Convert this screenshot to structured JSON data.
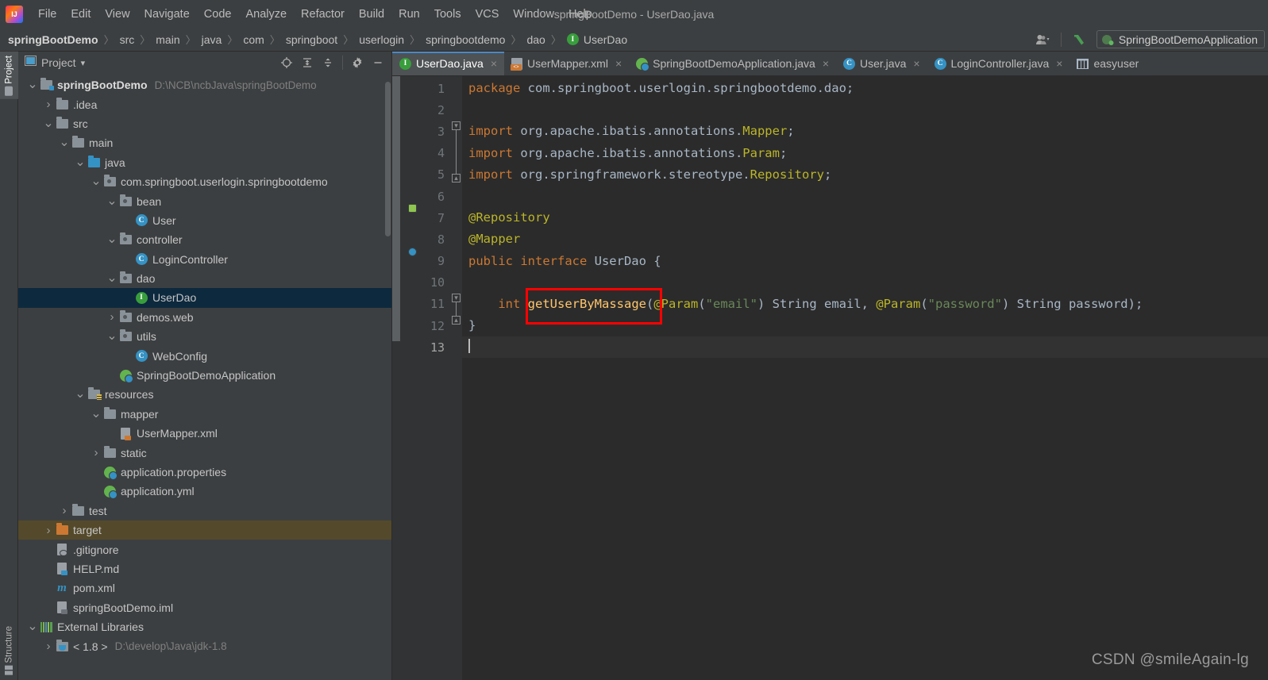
{
  "window": {
    "title": "springBootDemo - UserDao.java"
  },
  "menubar": {
    "items": [
      {
        "label": "File",
        "mnemonic": "F"
      },
      {
        "label": "Edit",
        "mnemonic": "E"
      },
      {
        "label": "View",
        "mnemonic": "V"
      },
      {
        "label": "Navigate",
        "mnemonic": "N"
      },
      {
        "label": "Code",
        "mnemonic": "C"
      },
      {
        "label": "Analyze",
        "mnemonic": "z"
      },
      {
        "label": "Refactor",
        "mnemonic": "R"
      },
      {
        "label": "Build",
        "mnemonic": "B"
      },
      {
        "label": "Run",
        "mnemonic": "u"
      },
      {
        "label": "Tools",
        "mnemonic": "T"
      },
      {
        "label": "VCS",
        "mnemonic": "S"
      },
      {
        "label": "Window",
        "mnemonic": "W"
      },
      {
        "label": "Help",
        "mnemonic": "H"
      }
    ]
  },
  "breadcrumb": {
    "separator": "〉",
    "items": [
      {
        "label": "springBootDemo",
        "bold": true,
        "icon": ""
      },
      {
        "label": "src",
        "bold": false,
        "icon": ""
      },
      {
        "label": "main",
        "bold": false,
        "icon": ""
      },
      {
        "label": "java",
        "bold": false,
        "icon": ""
      },
      {
        "label": "com",
        "bold": false,
        "icon": ""
      },
      {
        "label": "springboot",
        "bold": false,
        "icon": ""
      },
      {
        "label": "userlogin",
        "bold": false,
        "icon": ""
      },
      {
        "label": "springbootdemo",
        "bold": false,
        "icon": ""
      },
      {
        "label": "dao",
        "bold": false,
        "icon": ""
      },
      {
        "label": "UserDao",
        "bold": false,
        "icon": "interface-icon"
      }
    ],
    "right": {
      "user_icon": "user-dropdown-icon",
      "hammer_icon": "build-hammer-icon",
      "run_config_label": "SpringBootDemoApplication",
      "run_config_icon": "spring-boot-icon"
    }
  },
  "toolstrip": {
    "project_tab": "Project",
    "structure_tab": "Structure"
  },
  "project_panel": {
    "title": "Project",
    "dropdown_glyph": "▾",
    "icons": [
      {
        "name": "locate-icon",
        "glyph": "⊕"
      },
      {
        "name": "expand-all-icon",
        "glyph": "⇕"
      },
      {
        "name": "collapse-all-icon",
        "glyph": "⇵"
      },
      {
        "name": "settings-gear-icon",
        "glyph": "⚙"
      },
      {
        "name": "hide-panel-icon",
        "glyph": "—"
      }
    ],
    "tree": [
      {
        "indent": 0,
        "twist": "down",
        "icon": "module-folder-icon",
        "label": "springBootDemo",
        "bold": true,
        "path": "D:\\NCB\\ncbJava\\springBootDemo",
        "state": "normal"
      },
      {
        "indent": 1,
        "twist": "right",
        "icon": "folder-icon",
        "label": ".idea",
        "bold": false,
        "path": "",
        "state": "normal"
      },
      {
        "indent": 1,
        "twist": "down",
        "icon": "folder-icon",
        "label": "src",
        "bold": false,
        "path": "",
        "state": "normal"
      },
      {
        "indent": 2,
        "twist": "down",
        "icon": "folder-icon",
        "label": "main",
        "bold": false,
        "path": "",
        "state": "normal"
      },
      {
        "indent": 3,
        "twist": "down",
        "icon": "source-folder-icon",
        "label": "java",
        "bold": false,
        "path": "",
        "state": "normal"
      },
      {
        "indent": 4,
        "twist": "down",
        "icon": "package-icon",
        "label": "com.springboot.userlogin.springbootdemo",
        "bold": false,
        "path": "",
        "state": "normal"
      },
      {
        "indent": 5,
        "twist": "down",
        "icon": "package-icon",
        "label": "bean",
        "bold": false,
        "path": "",
        "state": "normal"
      },
      {
        "indent": 6,
        "twist": "none",
        "icon": "class-icon",
        "label": "User",
        "bold": false,
        "path": "",
        "state": "normal"
      },
      {
        "indent": 5,
        "twist": "down",
        "icon": "package-icon",
        "label": "controller",
        "bold": false,
        "path": "",
        "state": "normal"
      },
      {
        "indent": 6,
        "twist": "none",
        "icon": "class-icon",
        "label": "LoginController",
        "bold": false,
        "path": "",
        "state": "normal"
      },
      {
        "indent": 5,
        "twist": "down",
        "icon": "package-icon",
        "label": "dao",
        "bold": false,
        "path": "",
        "state": "normal"
      },
      {
        "indent": 6,
        "twist": "none",
        "icon": "interface-icon",
        "label": "UserDao",
        "bold": false,
        "path": "",
        "state": "selected"
      },
      {
        "indent": 5,
        "twist": "right",
        "icon": "package-icon",
        "label": "demos.web",
        "bold": false,
        "path": "",
        "state": "normal"
      },
      {
        "indent": 5,
        "twist": "down",
        "icon": "package-icon",
        "label": "utils",
        "bold": false,
        "path": "",
        "state": "normal"
      },
      {
        "indent": 6,
        "twist": "none",
        "icon": "class-icon",
        "label": "WebConfig",
        "bold": false,
        "path": "",
        "state": "normal"
      },
      {
        "indent": 5,
        "twist": "none",
        "icon": "spring-boot-app-icon",
        "label": "SpringBootDemoApplication",
        "bold": false,
        "path": "",
        "state": "normal"
      },
      {
        "indent": 3,
        "twist": "down",
        "icon": "resources-folder-icon",
        "label": "resources",
        "bold": false,
        "path": "",
        "state": "normal"
      },
      {
        "indent": 4,
        "twist": "down",
        "icon": "folder-icon",
        "label": "mapper",
        "bold": false,
        "path": "",
        "state": "normal"
      },
      {
        "indent": 5,
        "twist": "none",
        "icon": "xml-file-icon",
        "label": "UserMapper.xml",
        "bold": false,
        "path": "",
        "state": "normal"
      },
      {
        "indent": 4,
        "twist": "right",
        "icon": "folder-icon",
        "label": "static",
        "bold": false,
        "path": "",
        "state": "normal"
      },
      {
        "indent": 4,
        "twist": "none",
        "icon": "spring-config-icon",
        "label": "application.properties",
        "bold": false,
        "path": "",
        "state": "normal"
      },
      {
        "indent": 4,
        "twist": "none",
        "icon": "spring-config-icon",
        "label": "application.yml",
        "bold": false,
        "path": "",
        "state": "normal"
      },
      {
        "indent": 2,
        "twist": "right",
        "icon": "folder-icon",
        "label": "test",
        "bold": false,
        "path": "",
        "state": "normal"
      },
      {
        "indent": 1,
        "twist": "right",
        "icon": "target-folder-icon",
        "label": "target",
        "bold": false,
        "path": "",
        "state": "highlight"
      },
      {
        "indent": 1,
        "twist": "none",
        "icon": "gitignore-file-icon",
        "label": ".gitignore",
        "bold": false,
        "path": "",
        "state": "normal"
      },
      {
        "indent": 1,
        "twist": "none",
        "icon": "markdown-file-icon",
        "label": "HELP.md",
        "bold": false,
        "path": "",
        "state": "normal"
      },
      {
        "indent": 1,
        "twist": "none",
        "icon": "maven-file-icon",
        "label": "pom.xml",
        "bold": false,
        "path": "",
        "state": "normal"
      },
      {
        "indent": 1,
        "twist": "none",
        "icon": "iml-file-icon",
        "label": "springBootDemo.iml",
        "bold": false,
        "path": "",
        "state": "normal"
      },
      {
        "indent": 0,
        "twist": "down",
        "icon": "external-libraries-icon",
        "label": "External Libraries",
        "bold": false,
        "path": "",
        "state": "normal"
      },
      {
        "indent": 1,
        "twist": "right",
        "icon": "jdk-folder-icon",
        "label": "< 1.8 >",
        "bold": false,
        "path": "D:\\develop\\Java\\jdk-1.8",
        "state": "normal"
      }
    ]
  },
  "editor_tabs": [
    {
      "label": "UserDao.java",
      "icon": "interface-icon",
      "active": true,
      "closable": true
    },
    {
      "label": "UserMapper.xml",
      "icon": "xml-file-icon",
      "active": false,
      "closable": true
    },
    {
      "label": "SpringBootDemoApplication.java",
      "icon": "spring-boot-app-icon",
      "active": false,
      "closable": true
    },
    {
      "label": "User.java",
      "icon": "class-icon",
      "active": false,
      "closable": true
    },
    {
      "label": "LoginController.java",
      "icon": "class-icon",
      "active": false,
      "closable": true
    },
    {
      "label": "easyuser",
      "icon": "database-table-icon",
      "active": false,
      "closable": false
    }
  ],
  "editor": {
    "line_numbers": [
      "1",
      "2",
      "3",
      "4",
      "5",
      "6",
      "7",
      "8",
      "9",
      "10",
      "11",
      "12",
      "13"
    ],
    "current_line": 13,
    "gutter_marks": [
      {
        "line": 7,
        "icon": "spring-bean-icon"
      },
      {
        "line": 9,
        "icon": "spring-mapper-icon"
      }
    ],
    "lines": [
      {
        "n": 1,
        "tokens": [
          {
            "t": "package",
            "c": "kw"
          },
          {
            "t": " com.springboot.userlogin.springbootdemo.dao;",
            "c": "plain"
          }
        ]
      },
      {
        "n": 2,
        "tokens": []
      },
      {
        "n": 3,
        "tokens": [
          {
            "t": "import",
            "c": "kw"
          },
          {
            "t": " org.apache.ibatis.annotations.",
            "c": "plain"
          },
          {
            "t": "Mapper",
            "c": "ann"
          },
          {
            "t": ";",
            "c": "plain"
          }
        ]
      },
      {
        "n": 4,
        "tokens": [
          {
            "t": "import",
            "c": "kw"
          },
          {
            "t": " org.apache.ibatis.annotations.",
            "c": "plain"
          },
          {
            "t": "Param",
            "c": "ann"
          },
          {
            "t": ";",
            "c": "plain"
          }
        ]
      },
      {
        "n": 5,
        "tokens": [
          {
            "t": "import",
            "c": "kw"
          },
          {
            "t": " org.springframework.stereotype.",
            "c": "plain"
          },
          {
            "t": "Repository",
            "c": "ann"
          },
          {
            "t": ";",
            "c": "plain"
          }
        ]
      },
      {
        "n": 6,
        "tokens": []
      },
      {
        "n": 7,
        "tokens": [
          {
            "t": "@Repository",
            "c": "ann"
          }
        ]
      },
      {
        "n": 8,
        "tokens": [
          {
            "t": "@Mapper",
            "c": "ann"
          }
        ]
      },
      {
        "n": 9,
        "tokens": [
          {
            "t": "public interface ",
            "c": "kw"
          },
          {
            "t": "UserDao",
            "c": "cls"
          },
          {
            "t": " {",
            "c": "plain"
          }
        ]
      },
      {
        "n": 10,
        "tokens": []
      },
      {
        "n": 11,
        "tokens": [
          {
            "t": "    ",
            "c": "plain"
          },
          {
            "t": "int",
            "c": "kw"
          },
          {
            "t": " ",
            "c": "plain"
          },
          {
            "t": "getUserByMassage",
            "c": "mth"
          },
          {
            "t": "(",
            "c": "plain"
          },
          {
            "t": "@Param",
            "c": "ann"
          },
          {
            "t": "(",
            "c": "plain"
          },
          {
            "t": "\"email\"",
            "c": "str"
          },
          {
            "t": ") String email, ",
            "c": "plain"
          },
          {
            "t": "@Param",
            "c": "ann"
          },
          {
            "t": "(",
            "c": "plain"
          },
          {
            "t": "\"password\"",
            "c": "str"
          },
          {
            "t": ") String password);",
            "c": "plain"
          }
        ]
      },
      {
        "n": 12,
        "tokens": [
          {
            "t": "}",
            "c": "plain"
          }
        ]
      },
      {
        "n": 13,
        "tokens": []
      }
    ],
    "annotation_box": {
      "target_text": "getUserByMassage",
      "color": "#ff0000",
      "line": 11
    }
  },
  "watermark": "CSDN @smileAgain-lg",
  "colors": {
    "background": "#3c3f41",
    "editor_bg": "#2b2b2b",
    "gutter_bg": "#313335",
    "selection": "#0d293e",
    "highlight": "#54492a",
    "accent": "#4a88c7",
    "keyword": "#cc7832",
    "annotation": "#bbb529",
    "string": "#6a8759",
    "method": "#ffc66d",
    "text": "#a9b7c6",
    "box_red": "#ff0000"
  }
}
